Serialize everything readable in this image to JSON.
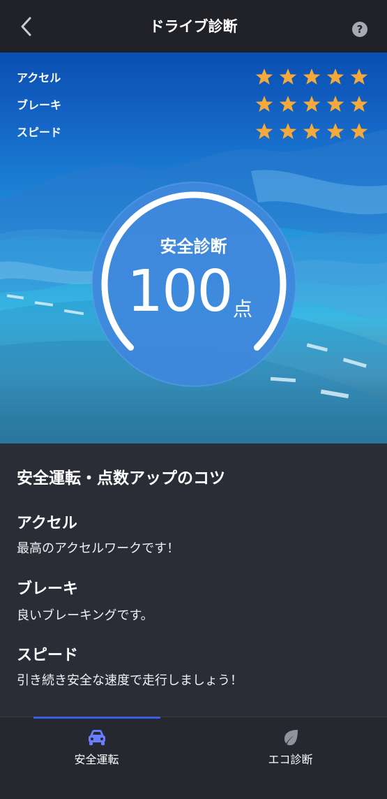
{
  "header": {
    "title": "ドライブ診断",
    "help_label": "?"
  },
  "ratings": [
    {
      "label": "アクセル",
      "stars": 5,
      "max_stars": 5
    },
    {
      "label": "ブレーキ",
      "stars": 5,
      "max_stars": 5
    },
    {
      "label": "スピード",
      "stars": 5,
      "max_stars": 5
    }
  ],
  "score": {
    "label": "安全診断",
    "value": "100",
    "unit": "点",
    "gauge_fraction": 1.0
  },
  "tips": {
    "heading": "安全運転・点数アップのコツ",
    "items": [
      {
        "title": "アクセル",
        "text": "最高のアクセルワークです！"
      },
      {
        "title": "ブレーキ",
        "text": "良いブレーキングです。"
      },
      {
        "title": "スピード",
        "text": "引き続き安全な速度で走行しましょう！"
      }
    ]
  },
  "bottom_nav": {
    "tabs": [
      {
        "label": "安全運転",
        "icon": "car-icon",
        "active": true
      },
      {
        "label": "エコ診断",
        "icon": "leaf-icon",
        "active": false
      }
    ]
  },
  "colors": {
    "star": "#f5a93b",
    "accent": "#3a5fe0",
    "header_bg": "#202228",
    "content_bg": "#2a2d36"
  }
}
